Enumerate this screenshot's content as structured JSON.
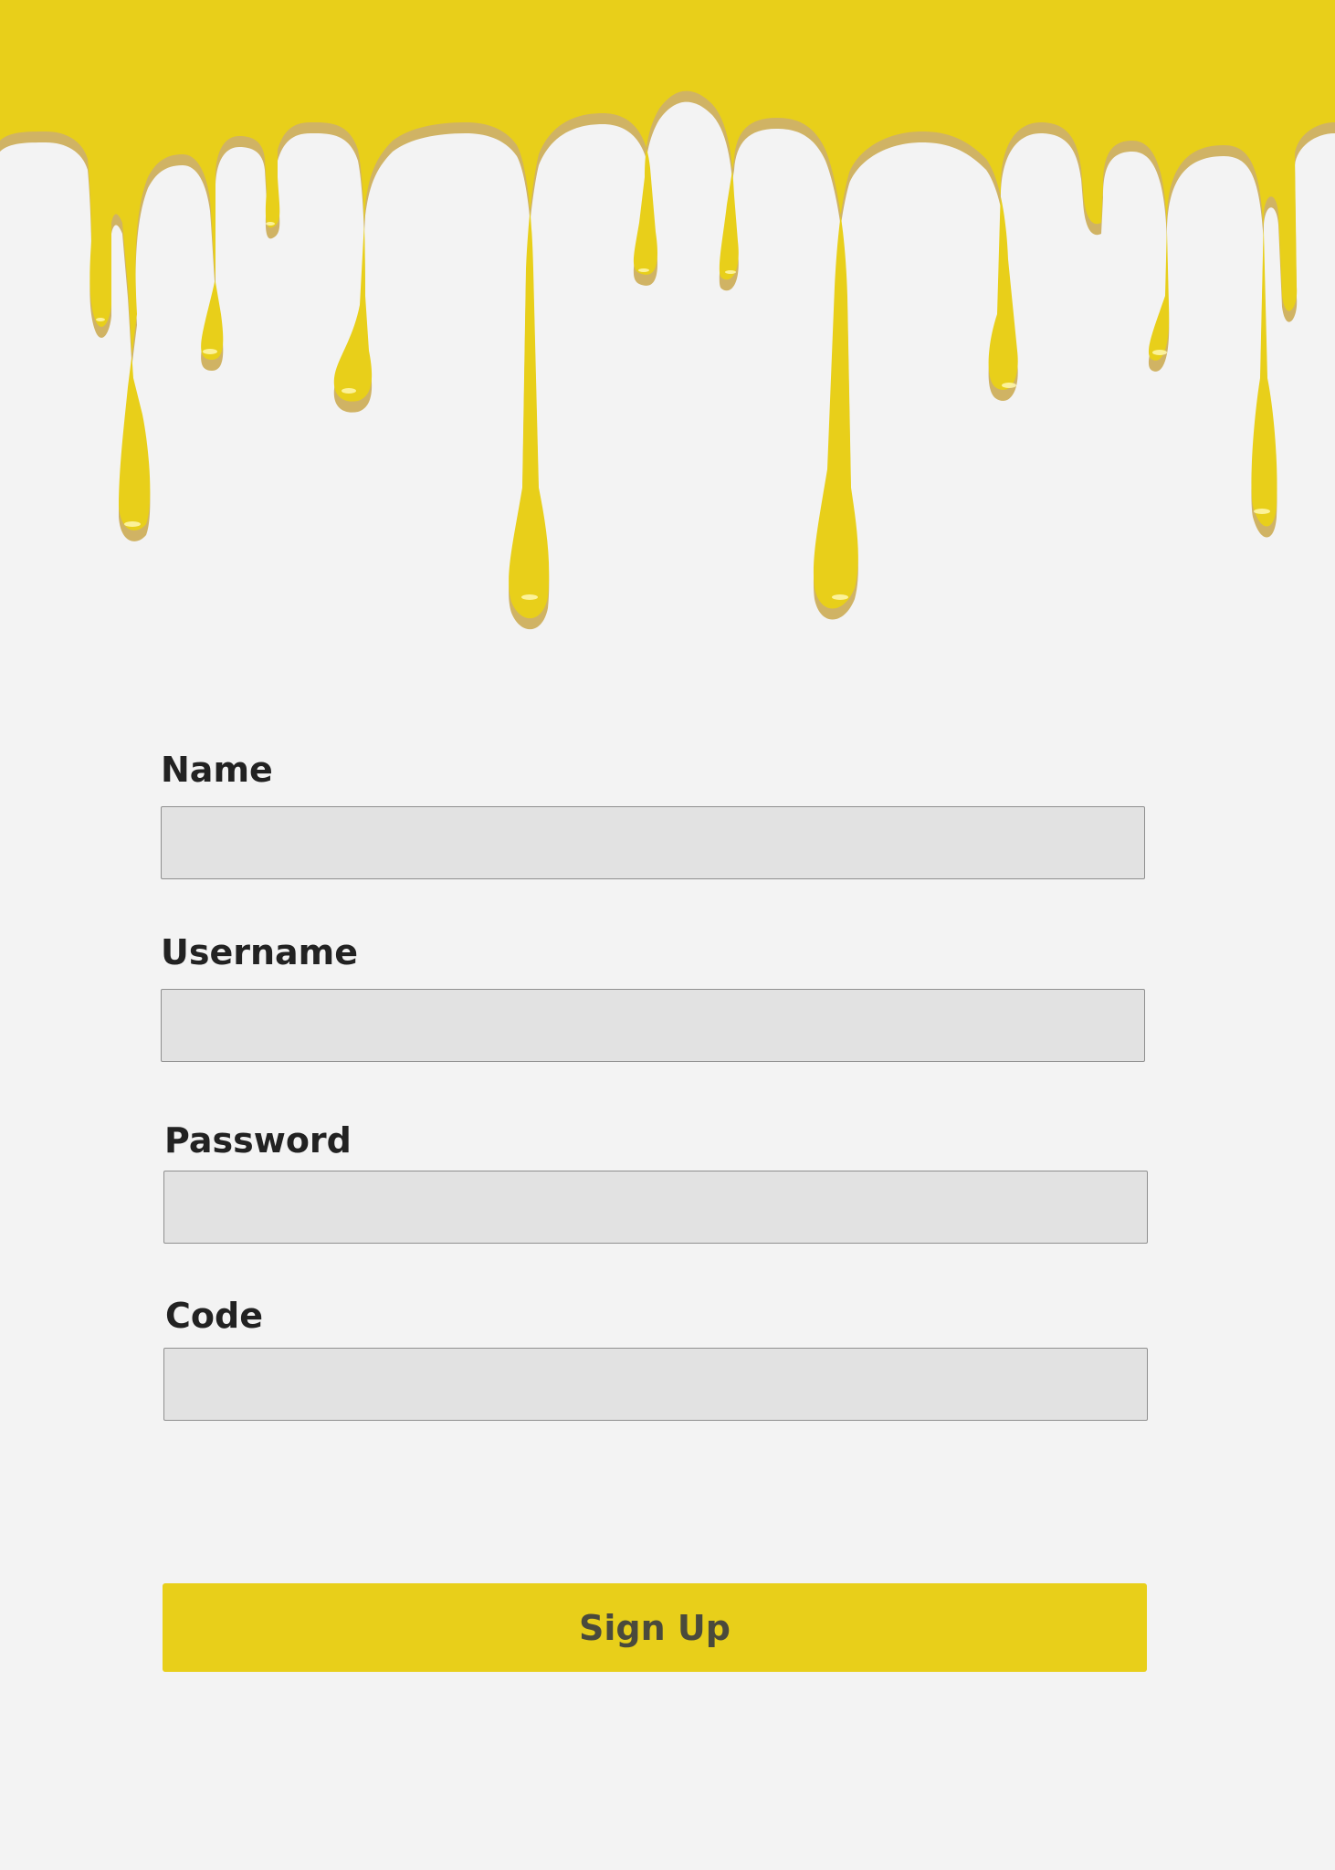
{
  "theme": {
    "accent": "#e8cf1a",
    "background": "#f3f3f3",
    "input_background": "#e2e2e2",
    "input_border": "#8f8f8f",
    "label_color": "#222222",
    "button_text_color": "#4a4a3c"
  },
  "header": {
    "decoration": "dripping-paint-graphic"
  },
  "form": {
    "fields": [
      {
        "label": "Name",
        "value": "",
        "type": "text"
      },
      {
        "label": "Username",
        "value": "",
        "type": "text"
      },
      {
        "label": "Password",
        "value": "",
        "type": "password"
      },
      {
        "label": "Code",
        "value": "",
        "type": "text"
      }
    ],
    "submit_label": "Sign Up"
  }
}
